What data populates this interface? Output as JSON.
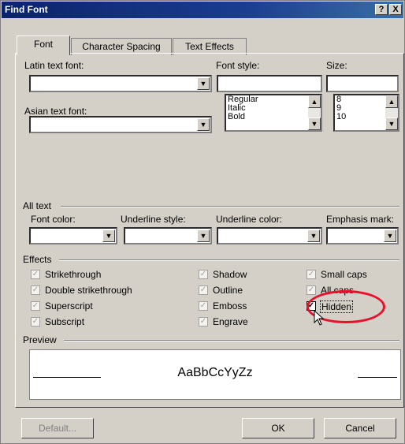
{
  "window": {
    "title": "Find Font",
    "help_glyph": "?",
    "close_glyph": "X"
  },
  "tabs": [
    {
      "label": "Font",
      "active": true
    },
    {
      "label": "Character Spacing",
      "active": false
    },
    {
      "label": "Text Effects",
      "active": false
    }
  ],
  "font_section": {
    "latin_label": "Latin text font:",
    "latin_value": "",
    "style_label": "Font style:",
    "style_value": "",
    "size_label": "Size:",
    "size_value": "",
    "asian_label": "Asian text font:",
    "asian_value": "",
    "style_options": [
      "Regular",
      "Italic",
      "Bold"
    ],
    "size_options": [
      "8",
      "9",
      "10"
    ]
  },
  "all_text": {
    "group_label": "All text",
    "font_color_label": "Font color:",
    "underline_style_label": "Underline style:",
    "underline_color_label": "Underline color:",
    "emphasis_label": "Emphasis mark:"
  },
  "effects": {
    "group_label": "Effects",
    "items": [
      {
        "label": "Strikethrough",
        "checked": true,
        "state": "disabled"
      },
      {
        "label": "Double strikethrough",
        "checked": true,
        "state": "disabled"
      },
      {
        "label": "Superscript",
        "checked": true,
        "state": "disabled"
      },
      {
        "label": "Subscript",
        "checked": true,
        "state": "disabled"
      },
      {
        "label": "Shadow",
        "checked": true,
        "state": "disabled"
      },
      {
        "label": "Outline",
        "checked": true,
        "state": "disabled"
      },
      {
        "label": "Emboss",
        "checked": true,
        "state": "disabled"
      },
      {
        "label": "Engrave",
        "checked": true,
        "state": "disabled"
      },
      {
        "label": "Small caps",
        "checked": true,
        "state": "disabled"
      },
      {
        "label": "All caps",
        "checked": true,
        "state": "disabled"
      },
      {
        "label": "Hidden",
        "checked": true,
        "state": "enabled"
      }
    ]
  },
  "preview": {
    "group_label": "Preview",
    "sample": "AaBbCcYyZz"
  },
  "buttons": {
    "default": "Default...",
    "ok": "OK",
    "cancel": "Cancel"
  },
  "colors": {
    "highlight_circle": "#e8102a",
    "title_bar": "#0a246a",
    "dialog_face": "#d4d0c8"
  }
}
